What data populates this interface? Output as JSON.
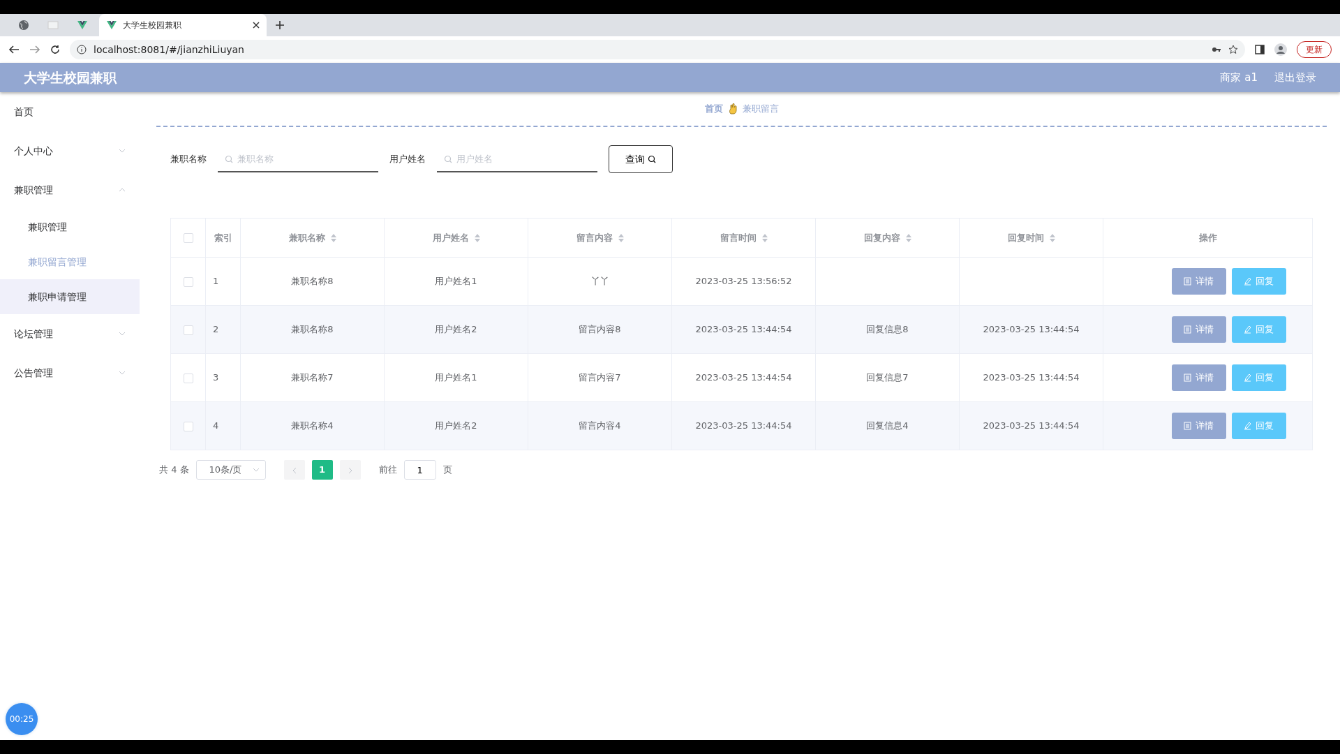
{
  "browser": {
    "tabs": [
      {
        "kind": "globe",
        "selected": false
      },
      {
        "kind": "blank",
        "selected": false
      },
      {
        "kind": "vue",
        "selected": false
      },
      {
        "kind": "vue",
        "title": "大学生校园兼职",
        "selected": true
      }
    ],
    "address": "localhost:8081/#/jianzhiLiuyan",
    "update_button": "更新"
  },
  "header": {
    "title": "大学生校园兼职",
    "user": "商家 a1",
    "logout": "退出登录"
  },
  "sidebar": {
    "items": [
      {
        "label": "首页",
        "hovered": false,
        "selected": false
      },
      {
        "label": "个人中心",
        "expanded": false,
        "hovered": false,
        "selected": false
      },
      {
        "label": "兼职管理",
        "expanded": true,
        "hovered": false,
        "selected": false,
        "children": [
          {
            "label": "兼职管理",
            "hovered": false,
            "selected": false
          },
          {
            "label": "兼职留言管理",
            "hovered": false,
            "selected": true
          },
          {
            "label": "兼职申请管理",
            "hovered": true,
            "selected": false
          }
        ]
      },
      {
        "label": "论坛管理",
        "expanded": false,
        "hovered": false,
        "selected": false
      },
      {
        "label": "公告管理",
        "expanded": false,
        "hovered": false,
        "selected": false
      }
    ]
  },
  "breadcrumb": [
    "首页",
    "兼职留言"
  ],
  "search": {
    "fields": [
      {
        "label": "兼职名称",
        "placeholder": "兼职名称"
      },
      {
        "label": "用户姓名",
        "placeholder": "用户姓名"
      }
    ],
    "button": "查询"
  },
  "table": {
    "columns": [
      {
        "label": "索引",
        "sortable": false
      },
      {
        "label": "兼职名称",
        "sortable": true
      },
      {
        "label": "用户姓名",
        "sortable": true
      },
      {
        "label": "留言内容",
        "sortable": true
      },
      {
        "label": "留言时间",
        "sortable": true
      },
      {
        "label": "回复内容",
        "sortable": true
      },
      {
        "label": "回复时间",
        "sortable": true
      },
      {
        "label": "操作",
        "sortable": false
      }
    ],
    "all_checked": false,
    "rows": [
      {
        "checked": false,
        "cells": [
          "1",
          "兼职名称8",
          "用户姓名1",
          "丫丫",
          "2023-03-25 13:56:52",
          "",
          ""
        ],
        "actions": [
          "详情",
          "回复"
        ]
      },
      {
        "checked": false,
        "cells": [
          "2",
          "兼职名称8",
          "用户姓名2",
          "留言内容8",
          "2023-03-25 13:44:54",
          "回复信息8",
          "2023-03-25 13:44:54"
        ],
        "actions": [
          "详情",
          "回复"
        ]
      },
      {
        "checked": false,
        "cells": [
          "3",
          "兼职名称7",
          "用户姓名1",
          "留言内容7",
          "2023-03-25 13:44:54",
          "回复信息7",
          "2023-03-25 13:44:54"
        ],
        "actions": [
          "详情",
          "回复"
        ]
      },
      {
        "checked": false,
        "cells": [
          "4",
          "兼职名称4",
          "用户姓名2",
          "留言内容4",
          "2023-03-25 13:44:54",
          "回复信息4",
          "2023-03-25 13:44:54"
        ],
        "actions": [
          "详情",
          "回复"
        ]
      }
    ]
  },
  "pagination": {
    "total": "共 4 条",
    "page_size": "10条/页",
    "pages": [
      {
        "label": "1",
        "selected": true
      }
    ],
    "goto_label": "前往",
    "goto_value": "1",
    "goto_suffix": "页"
  },
  "timer": "00:25"
}
